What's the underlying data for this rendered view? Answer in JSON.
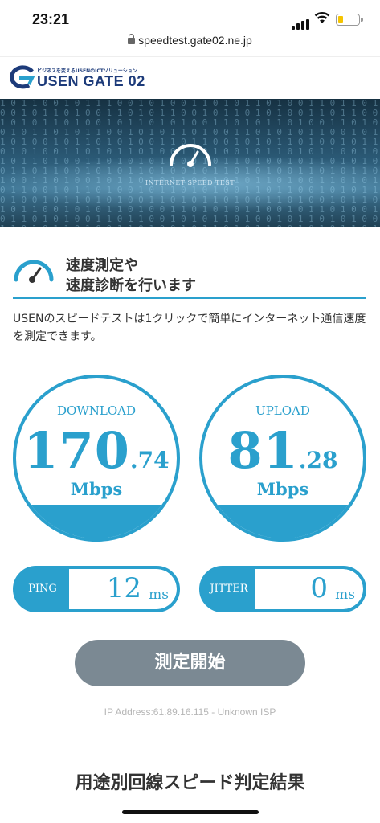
{
  "status_bar": {
    "time": "23:21"
  },
  "browser": {
    "url": "speedtest.gate02.ne.jp"
  },
  "header": {
    "tagline": "ビジネスを変えるUSENのICTソリューション",
    "logo_text": "USEN GATE 02"
  },
  "hero": {
    "title": "INTERNET SPEED TEST"
  },
  "headline": {
    "line1": "速度測定や",
    "line2": "速度診断を行います"
  },
  "intro": "USENのスピードテストは1クリックで簡単にインターネット通信速度を測定できます。",
  "download": {
    "label": "DOWNLOAD",
    "int": "170",
    "dec": ".74",
    "unit": "Mbps"
  },
  "upload": {
    "label": "UPLOAD",
    "int": "81",
    "dec": ".28",
    "unit": "Mbps"
  },
  "ping": {
    "label": "PING",
    "value": "12",
    "unit": "ms"
  },
  "jitter": {
    "label": "JITTER",
    "value": "0",
    "unit": "ms"
  },
  "start_button": "測定開始",
  "ip_info": "IP Address:61.89.16.115 - Unknown ISP",
  "section_title": "用途別回線スピード判定結果",
  "colors": {
    "accent": "#2aa0cd",
    "button": "#7b8993",
    "brand": "#1d3b7a"
  }
}
